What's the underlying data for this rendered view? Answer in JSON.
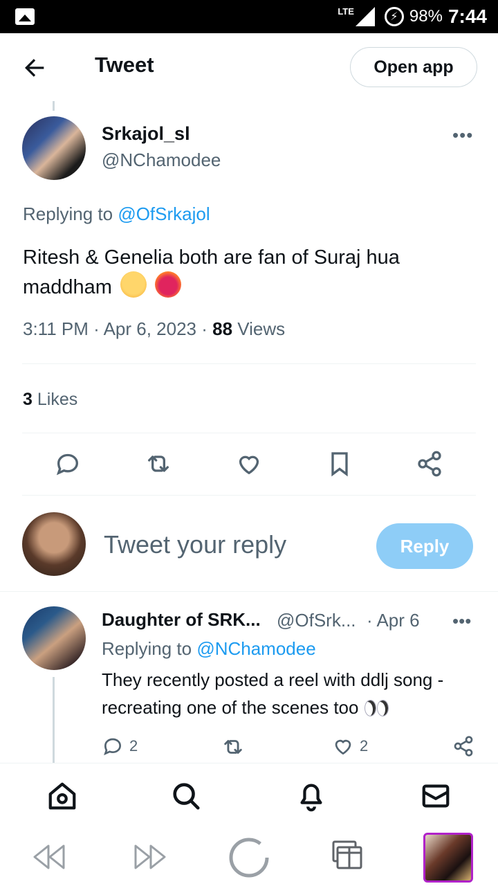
{
  "status_bar": {
    "network": "LTE",
    "battery": "98%",
    "time": "7:44"
  },
  "header": {
    "title": "Tweet",
    "open_app_label": "Open app"
  },
  "tweet": {
    "author_name": "Srkajol_sl",
    "author_handle": "@NChamodee",
    "replying_prefix": "Replying to",
    "replying_handle": "@OfSrkajol",
    "text": "Ritesh & Genelia both are fan of Suraj hua maddham",
    "time": "3:11 PM",
    "date": "Apr 6, 2023",
    "views_count": "88",
    "views_label": "Views",
    "likes_count": "3",
    "likes_label": "Likes"
  },
  "composer": {
    "placeholder": "Tweet your reply",
    "reply_label": "Reply"
  },
  "reply": {
    "author_name": "Daughter of SRK...",
    "author_handle": "@OfSrk...",
    "date": "· Apr 6",
    "replying_prefix": "Replying to",
    "replying_handle": "@NChamodee",
    "text": "They recently posted a reel with ddlj song - recreating one of the scenes too",
    "replies": "2",
    "likes": "2"
  },
  "colors": {
    "accent": "#1d9bf0",
    "reply_button": "#8ecdf7",
    "muted_text": "#536471"
  }
}
